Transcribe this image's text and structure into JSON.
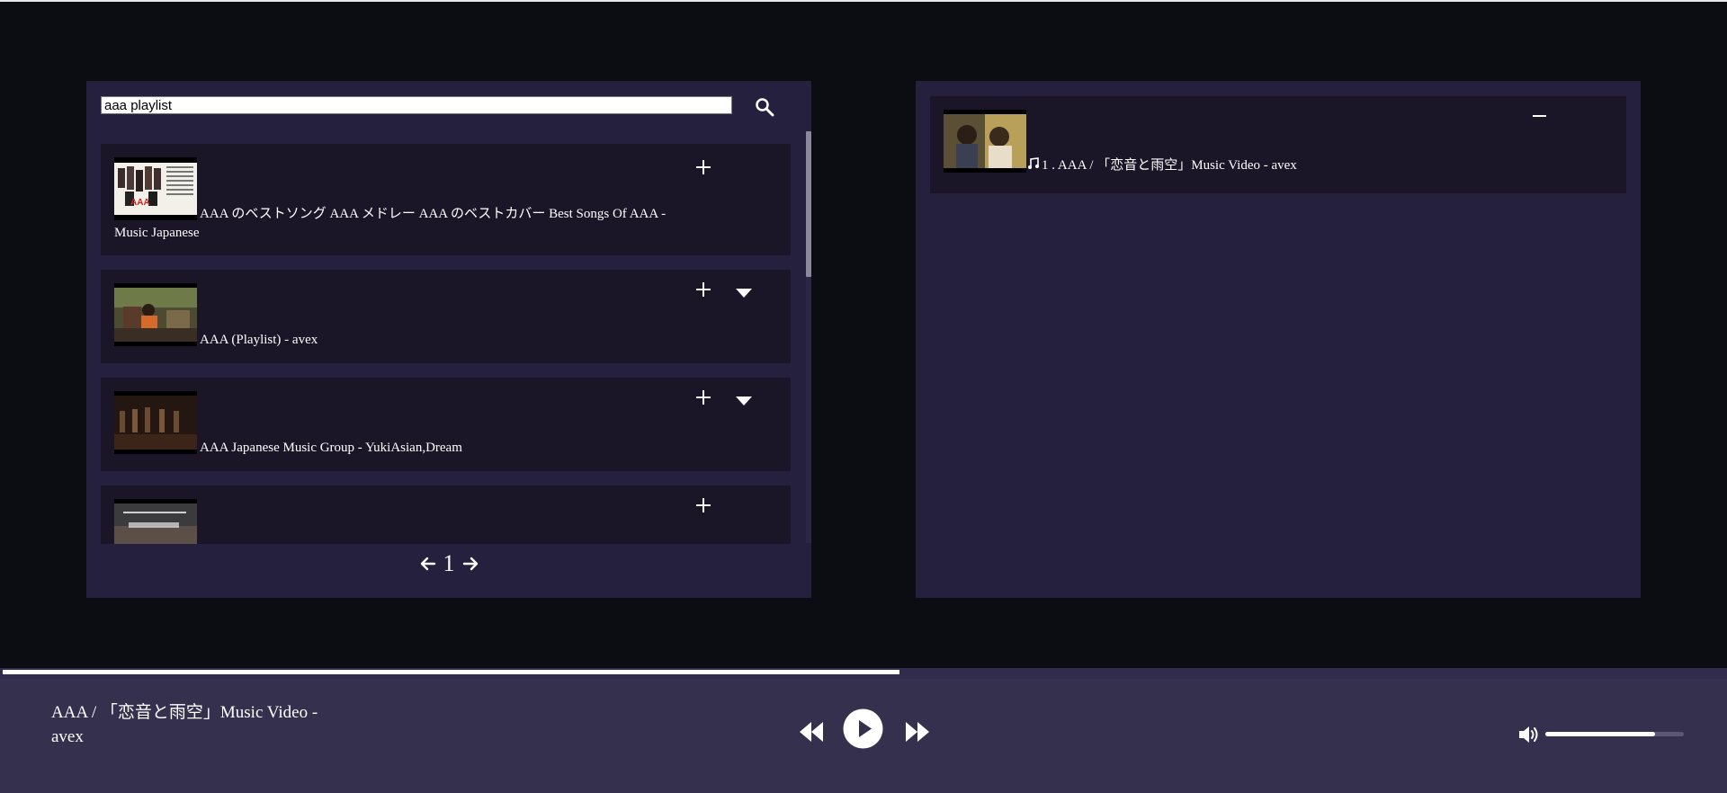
{
  "search": {
    "query": "aaa playlist",
    "button_icon": "search-icon"
  },
  "results": [
    {
      "title": "AAA のベストソング AAA メドレー AAA のベストカバー Best Songs Of AAA - Music Japanese",
      "has_expand": false
    },
    {
      "title": "AAA (Playlist) - avex",
      "has_expand": true
    },
    {
      "title": "AAA Japanese Music Group - YukiAsian,Dream",
      "has_expand": true
    },
    {
      "title": "",
      "has_expand": false
    }
  ],
  "pagination": {
    "page": "1"
  },
  "queue": [
    {
      "index_label": "1 . AAA / 「恋音と雨空」Music Video - avex",
      "icon": "music-note-icon"
    }
  ],
  "player": {
    "now_playing": "AAA / 「恋音と雨空」Music Video - avex",
    "progress": 0.52,
    "volume": 0.79
  },
  "colors": {
    "page_bg": "#0c0d12",
    "panel_bg": "#25203d",
    "item_bg": "#1a1628",
    "player_bg": "#36304f"
  }
}
